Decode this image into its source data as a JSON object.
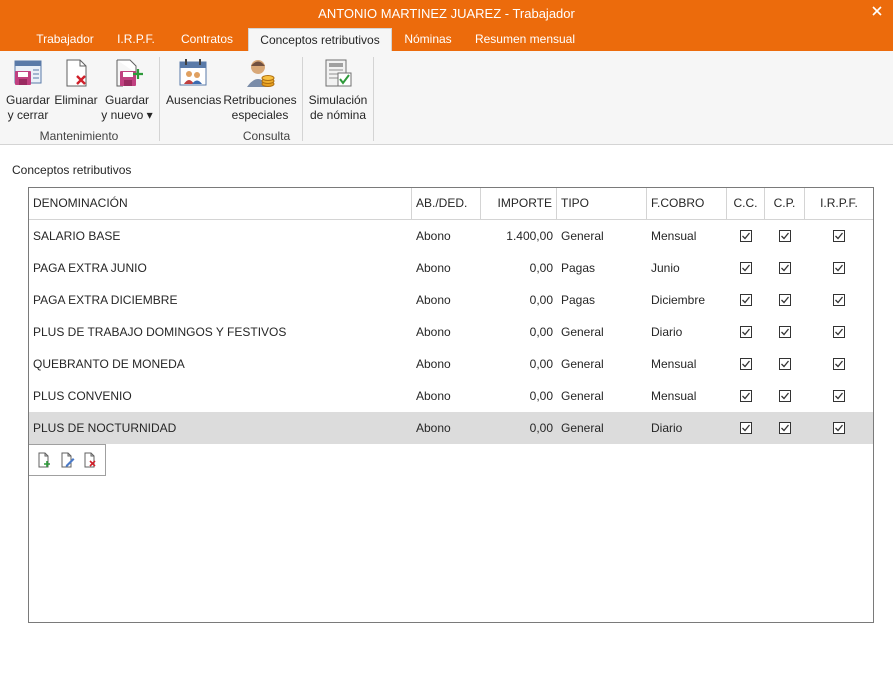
{
  "window": {
    "title": "ANTONIO MARTINEZ JUAREZ - Trabajador"
  },
  "tabs": [
    "Trabajador",
    "I.R.P.F.",
    "Contratos",
    "Conceptos retributivos",
    "Nóminas",
    "Resumen mensual"
  ],
  "active_tab": "Conceptos retributivos",
  "ribbon": {
    "save_close": [
      "Guardar",
      "y cerrar"
    ],
    "delete": "Eliminar",
    "save_new": [
      "Guardar",
      "y nuevo ▾"
    ],
    "absences": "Ausencias",
    "special_pay": [
      "Retribuciones",
      "especiales"
    ],
    "payroll_sim": [
      "Simulación",
      "de nómina"
    ],
    "group_mant": "Mantenimiento",
    "group_consulta": "Consulta"
  },
  "section_title": "Conceptos retributivos",
  "table": {
    "headers": [
      "DENOMINACIÓN",
      "AB./DED.",
      "IMPORTE",
      "TIPO",
      "F.COBRO",
      "C.C.",
      "C.P.",
      "I.R.P.F."
    ],
    "rows": [
      {
        "denominacion": "SALARIO BASE",
        "ab": "Abono",
        "importe": "1.400,00",
        "tipo": "General",
        "fcobro": "Mensual",
        "cc": true,
        "cp": true,
        "irpf": true
      },
      {
        "denominacion": "PAGA EXTRA JUNIO",
        "ab": "Abono",
        "importe": "0,00",
        "tipo": "Pagas",
        "fcobro": "Junio",
        "cc": true,
        "cp": true,
        "irpf": true
      },
      {
        "denominacion": "PAGA EXTRA DICIEMBRE",
        "ab": "Abono",
        "importe": "0,00",
        "tipo": "Pagas",
        "fcobro": "Diciembre",
        "cc": true,
        "cp": true,
        "irpf": true
      },
      {
        "denominacion": "PLUS DE TRABAJO DOMINGOS Y FESTIVOS",
        "ab": "Abono",
        "importe": "0,00",
        "tipo": "General",
        "fcobro": "Diario",
        "cc": true,
        "cp": true,
        "irpf": true
      },
      {
        "denominacion": "QUEBRANTO DE MONEDA",
        "ab": "Abono",
        "importe": "0,00",
        "tipo": "General",
        "fcobro": "Mensual",
        "cc": true,
        "cp": true,
        "irpf": true
      },
      {
        "denominacion": "PLUS CONVENIO",
        "ab": "Abono",
        "importe": "0,00",
        "tipo": "General",
        "fcobro": "Mensual",
        "cc": true,
        "cp": true,
        "irpf": true
      },
      {
        "denominacion": "PLUS DE NOCTURNIDAD",
        "ab": "Abono",
        "importe": "0,00",
        "tipo": "General",
        "fcobro": "Diario",
        "cc": true,
        "cp": true,
        "irpf": true
      }
    ],
    "selected_row": 6
  },
  "nav_icons": [
    "new-record-icon",
    "edit-record-icon",
    "delete-record-icon"
  ],
  "colors": {
    "accent": "#ec6b0c",
    "selected_row": "#dcdcdc"
  }
}
